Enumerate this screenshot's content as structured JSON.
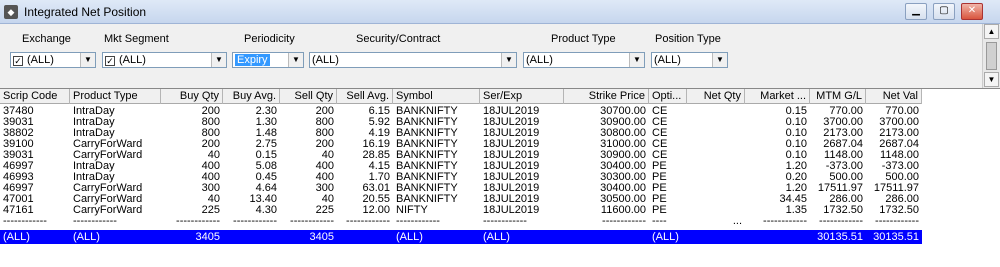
{
  "window": {
    "title": "Integrated Net Position",
    "icon": "app-icon"
  },
  "filters": {
    "labels": {
      "exchange": "Exchange",
      "mkt_segment": "Mkt Segment",
      "periodicity": "Periodicity",
      "security": "Security/Contract",
      "product_type": "Product Type",
      "position_type": "Position Type"
    },
    "values": {
      "exchange": "(ALL)",
      "mkt_segment": "(ALL)",
      "periodicity": "Expiry",
      "security": "(ALL)",
      "product_type": "(ALL)",
      "position_type": "(ALL)"
    }
  },
  "table": {
    "columns": [
      "Scrip Code",
      "Product Type",
      "Buy Qty",
      "Buy Avg.",
      "Sell Qty",
      "Sell Avg.",
      "Symbol",
      "Ser/Exp",
      "Strike Price",
      "Opti...",
      "Net Qty",
      "Market ...",
      "MTM G/L",
      "Net Val"
    ],
    "rows": [
      [
        "37480",
        "IntraDay",
        "200",
        "2.30",
        "200",
        "6.15",
        "BANKNIFTY",
        "18JUL2019",
        "30700.00",
        "CE",
        "",
        "0.15",
        "770.00",
        "770.00"
      ],
      [
        "39031",
        "IntraDay",
        "800",
        "1.30",
        "800",
        "5.92",
        "BANKNIFTY",
        "18JUL2019",
        "30900.00",
        "CE",
        "",
        "0.10",
        "3700.00",
        "3700.00"
      ],
      [
        "38802",
        "IntraDay",
        "800",
        "1.48",
        "800",
        "4.19",
        "BANKNIFTY",
        "18JUL2019",
        "30800.00",
        "CE",
        "",
        "0.10",
        "2173.00",
        "2173.00"
      ],
      [
        "39100",
        "CarryForWard",
        "200",
        "2.75",
        "200",
        "16.19",
        "BANKNIFTY",
        "18JUL2019",
        "31000.00",
        "CE",
        "",
        "0.10",
        "2687.04",
        "2687.04"
      ],
      [
        "39031",
        "CarryForWard",
        "40",
        "0.15",
        "40",
        "28.85",
        "BANKNIFTY",
        "18JUL2019",
        "30900.00",
        "CE",
        "",
        "0.10",
        "1148.00",
        "1148.00"
      ],
      [
        "46997",
        "IntraDay",
        "400",
        "5.08",
        "400",
        "4.15",
        "BANKNIFTY",
        "18JUL2019",
        "30400.00",
        "PE",
        "",
        "1.20",
        "-373.00",
        "-373.00"
      ],
      [
        "46993",
        "IntraDay",
        "400",
        "0.45",
        "400",
        "1.70",
        "BANKNIFTY",
        "18JUL2019",
        "30300.00",
        "PE",
        "",
        "0.20",
        "500.00",
        "500.00"
      ],
      [
        "46997",
        "CarryForWard",
        "300",
        "4.64",
        "300",
        "63.01",
        "BANKNIFTY",
        "18JUL2019",
        "30400.00",
        "PE",
        "",
        "1.20",
        "17511.97",
        "17511.97"
      ],
      [
        "47001",
        "CarryForWard",
        "40",
        "13.40",
        "40",
        "20.55",
        "BANKNIFTY",
        "18JUL2019",
        "30500.00",
        "PE",
        "",
        "34.45",
        "286.00",
        "286.00"
      ],
      [
        "47161",
        "CarryForWard",
        "225",
        "4.30",
        "225",
        "12.00",
        "NIFTY",
        "18JUL2019",
        "11600.00",
        "PE",
        "",
        "1.35",
        "1732.50",
        "1732.50"
      ]
    ],
    "separator": "------------",
    "separator_short": "----",
    "separator_dots": "...",
    "totals": [
      "(ALL)",
      "(ALL)",
      "3405",
      "",
      "3405",
      "",
      "(ALL)",
      "(ALL)",
      "",
      "(ALL)",
      "",
      "",
      "30135.51",
      "30135.51"
    ]
  },
  "colors": {
    "total_row_bg": "#0000ff",
    "selection": "#3399ff"
  }
}
